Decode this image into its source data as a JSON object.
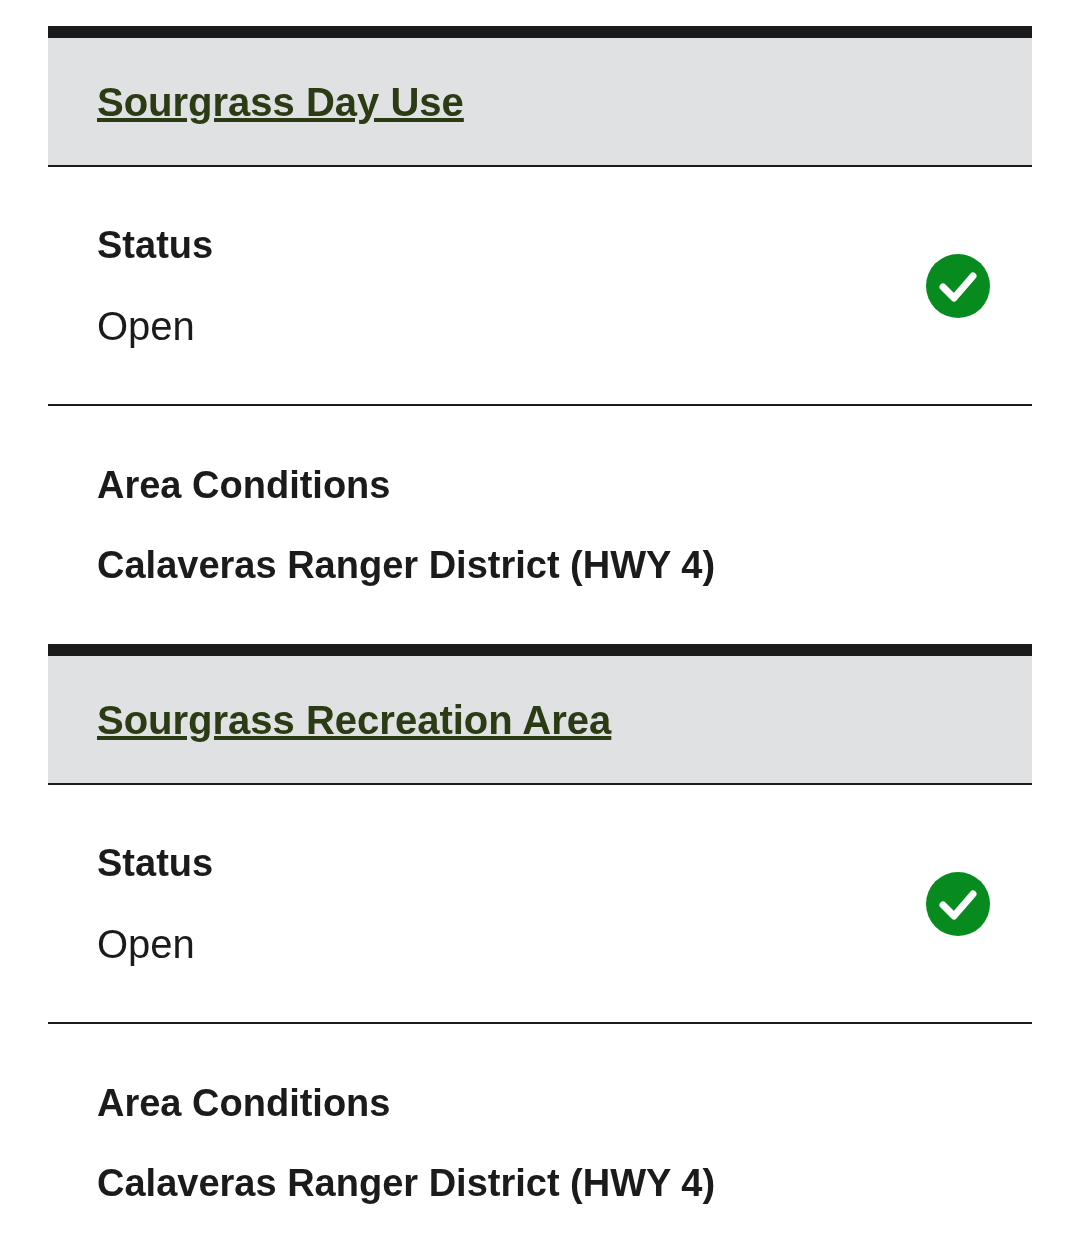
{
  "areas": [
    {
      "title": "Sourgrass Day Use",
      "status": {
        "label": "Status",
        "value": "Open",
        "kind": "open"
      },
      "conditions": {
        "label": "Area Conditions",
        "value": "Calaveras Ranger District (HWY 4)"
      }
    },
    {
      "title": "Sourgrass Recreation Area",
      "status": {
        "label": "Status",
        "value": "Open",
        "kind": "open"
      },
      "conditions": {
        "label": "Area Conditions",
        "value": "Calaveras Ranger District (HWY 4)"
      }
    }
  ]
}
